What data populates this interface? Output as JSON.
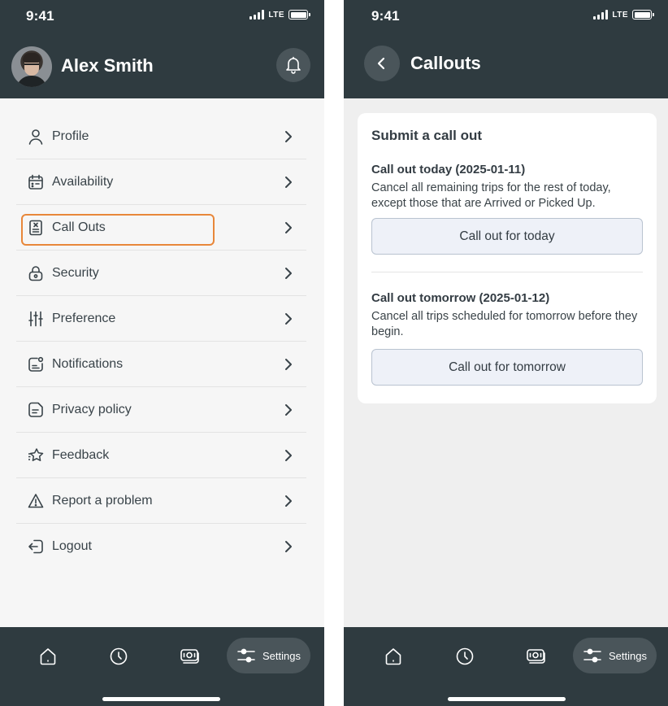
{
  "left_screen": {
    "status": {
      "time": "9:41",
      "network": "LTE"
    },
    "header": {
      "user_name": "Alex Smith"
    },
    "menu": [
      {
        "label": "Profile",
        "icon": "person-icon"
      },
      {
        "label": "Availability",
        "icon": "calendar-icon"
      },
      {
        "label": "Call Outs",
        "icon": "callout-document-icon",
        "highlighted": true
      },
      {
        "label": "Security",
        "icon": "lock-icon"
      },
      {
        "label": "Preference",
        "icon": "sliders-icon"
      },
      {
        "label": "Notifications",
        "icon": "notification-icon"
      },
      {
        "label": "Privacy policy",
        "icon": "document-icon"
      },
      {
        "label": "Feedback",
        "icon": "star-icon"
      },
      {
        "label": "Report a problem",
        "icon": "warning-icon"
      },
      {
        "label": "Logout",
        "icon": "logout-icon"
      }
    ],
    "tabbar": {
      "active_label": "Settings"
    }
  },
  "right_screen": {
    "status": {
      "time": "9:41",
      "network": "LTE"
    },
    "header": {
      "title": "Callouts"
    },
    "card": {
      "title": "Submit a call out",
      "today": {
        "title": "Call out today (2025-01-11)",
        "description": "Cancel all remaining trips for the rest of today, except those that are Arrived or Picked Up.",
        "button": "Call out for today"
      },
      "tomorrow": {
        "title": "Call out tomorrow (2025-01-12)",
        "description": "Cancel all trips scheduled for tomorrow before they begin.",
        "button": "Call out for tomorrow"
      }
    },
    "tabbar": {
      "active_label": "Settings"
    }
  },
  "colors": {
    "header_bg": "#2f3b40",
    "highlight": "#e8873a",
    "button_bg": "#eef1f8",
    "button_border": "#b9c3d0"
  }
}
